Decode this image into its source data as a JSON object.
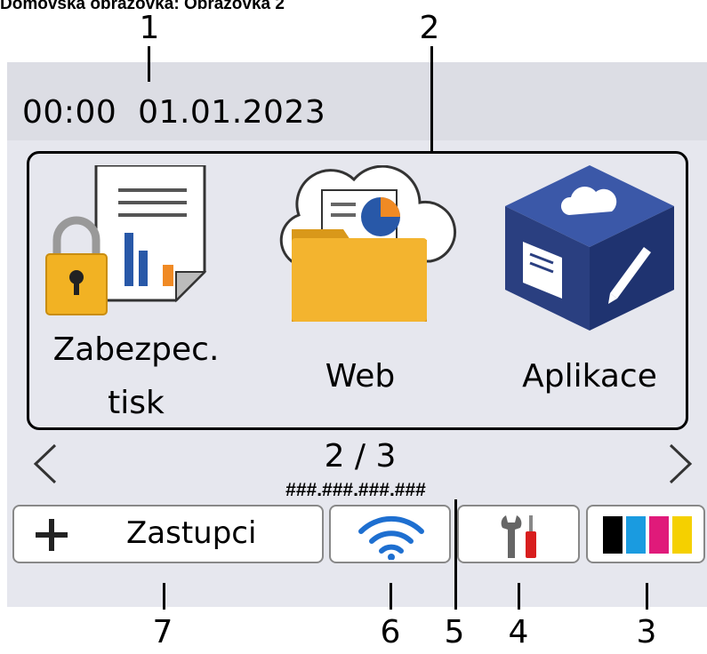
{
  "caption": "Domovská obrazovka: Obrazovka 2",
  "status": {
    "datetime": "00:00  01.01.2023"
  },
  "apps": [
    {
      "label_line1": "Zabezpec.",
      "label_line2": "tisk",
      "icon": "secure-print-icon"
    },
    {
      "label_line1": "Web",
      "icon": "web-folder-icon"
    },
    {
      "label_line1": "Aplikace",
      "icon": "apps-cube-icon"
    }
  ],
  "pager": {
    "text": "2 / 3"
  },
  "network": {
    "ip": "###.###.###.###"
  },
  "shortcuts": {
    "label": "Zastupci",
    "icon": "plus-icon"
  },
  "callouts": [
    "1",
    "2",
    "3",
    "4",
    "5",
    "6",
    "7"
  ],
  "colors": {
    "screen": "#e6e7ee",
    "folder": "#f3b42f",
    "cube": "#3b58a8",
    "wifi": "#1e6fd0",
    "lock": "#f2b223"
  },
  "ink": [
    "#000000",
    "#1a9be0",
    "#e01a7a",
    "#f5d000"
  ]
}
